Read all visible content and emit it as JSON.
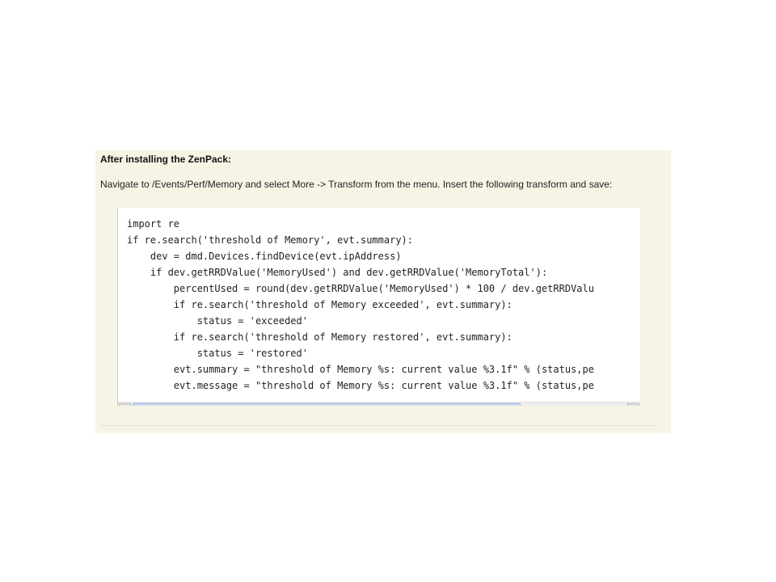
{
  "section": {
    "heading": "After installing the ZenPack:",
    "instructions": "Navigate to /Events/Perf/Memory and select More -> Transform from the menu.  Insert the following transform and save:"
  },
  "code": {
    "lines": [
      "import re",
      "if re.search('threshold of Memory', evt.summary):",
      "    dev = dmd.Devices.findDevice(evt.ipAddress)",
      "    if dev.getRRDValue('MemoryUsed') and dev.getRRDValue('MemoryTotal'):",
      "        percentUsed = round(dev.getRRDValue('MemoryUsed') * 100 / dev.getRRDValu",
      "        if re.search('threshold of Memory exceeded', evt.summary):",
      "            status = 'exceeded'",
      "        if re.search('threshold of Memory restored', evt.summary):",
      "            status = 'restored'",
      "        evt.summary = \"threshold of Memory %s: current value %3.1f\" % (status,pe",
      "        evt.message = \"threshold of Memory %s: current value %3.1f\" % (status,pe"
    ]
  },
  "scrollbar": {
    "left_arrow_icon": "chevron-left-icon",
    "right_arrow_icon": "chevron-right-icon",
    "position_fraction": 0.0,
    "visible_fraction": 0.78
  }
}
